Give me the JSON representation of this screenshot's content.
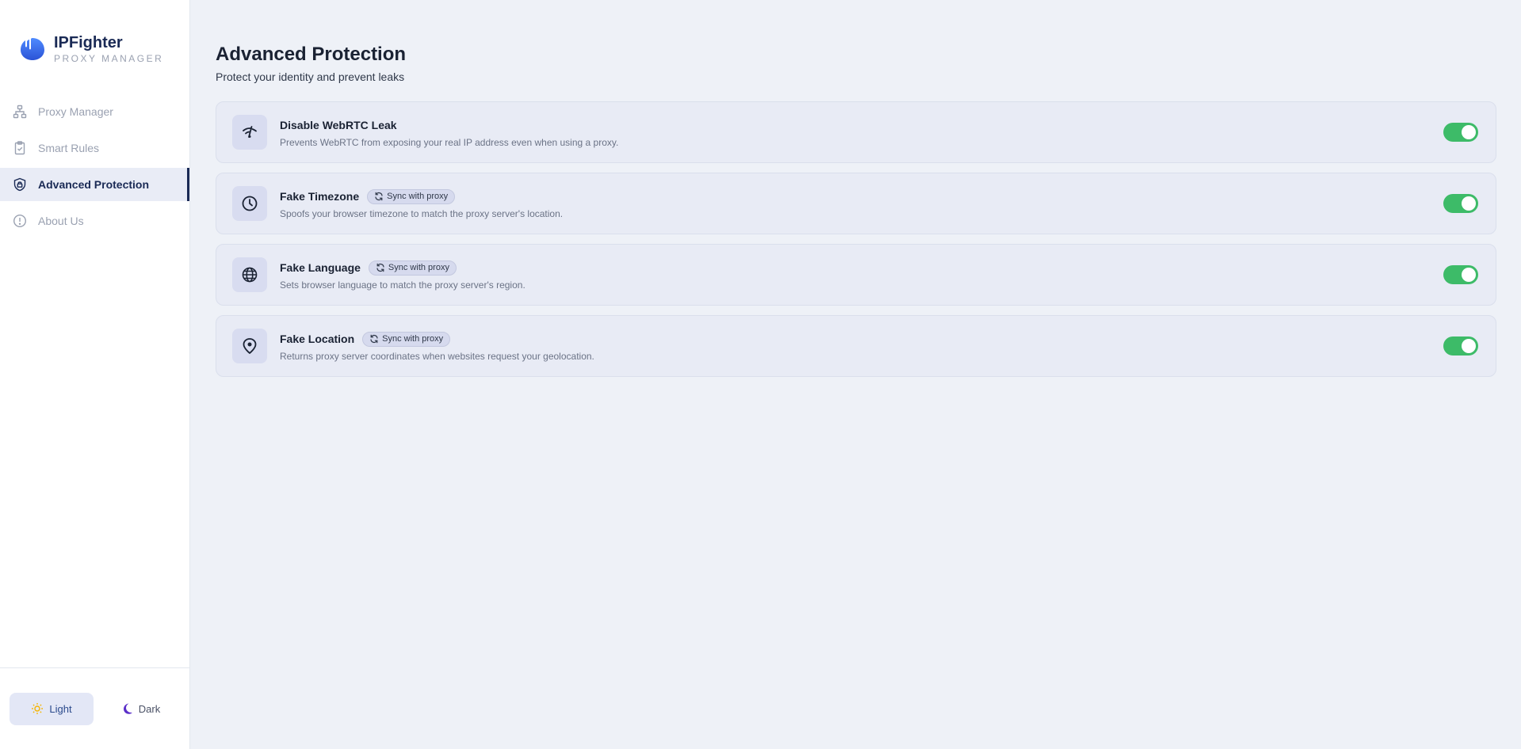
{
  "brand": {
    "name": "IPFighter",
    "subtitle": "PROXY MANAGER"
  },
  "sidebar": {
    "items": [
      {
        "label": "Proxy Manager",
        "icon": "network-icon",
        "active": false
      },
      {
        "label": "Smart Rules",
        "icon": "clipboard-check-icon",
        "active": false
      },
      {
        "label": "Advanced Protection",
        "icon": "shield-lock-icon",
        "active": true
      },
      {
        "label": "About Us",
        "icon": "info-circle-icon",
        "active": false
      }
    ]
  },
  "theme": {
    "light_label": "Light",
    "dark_label": "Dark",
    "selected": "light"
  },
  "page": {
    "title": "Advanced Protection",
    "subtitle": "Protect your identity and prevent leaks"
  },
  "features": [
    {
      "title": "Disable WebRTC Leak",
      "description": "Prevents WebRTC from exposing your real IP address even when using a proxy.",
      "badge": "",
      "icon": "wifi-off-icon",
      "enabled": true
    },
    {
      "title": "Fake Timezone",
      "description": "Spoofs your browser timezone to match the proxy server's location.",
      "badge": "Sync with proxy",
      "icon": "clock-icon",
      "enabled": true
    },
    {
      "title": "Fake Language",
      "description": "Sets browser language to match the proxy server's region.",
      "badge": "Sync with proxy",
      "icon": "globe-icon",
      "enabled": true
    },
    {
      "title": "Fake Location",
      "description": "Returns proxy server coordinates when websites request your geolocation.",
      "badge": "Sync with proxy",
      "icon": "map-pin-icon",
      "enabled": true
    }
  ],
  "colors": {
    "toggle_on": "#3dbb68",
    "brand_blue": "#3b6cf0",
    "accent_navy": "#1a2a55"
  }
}
